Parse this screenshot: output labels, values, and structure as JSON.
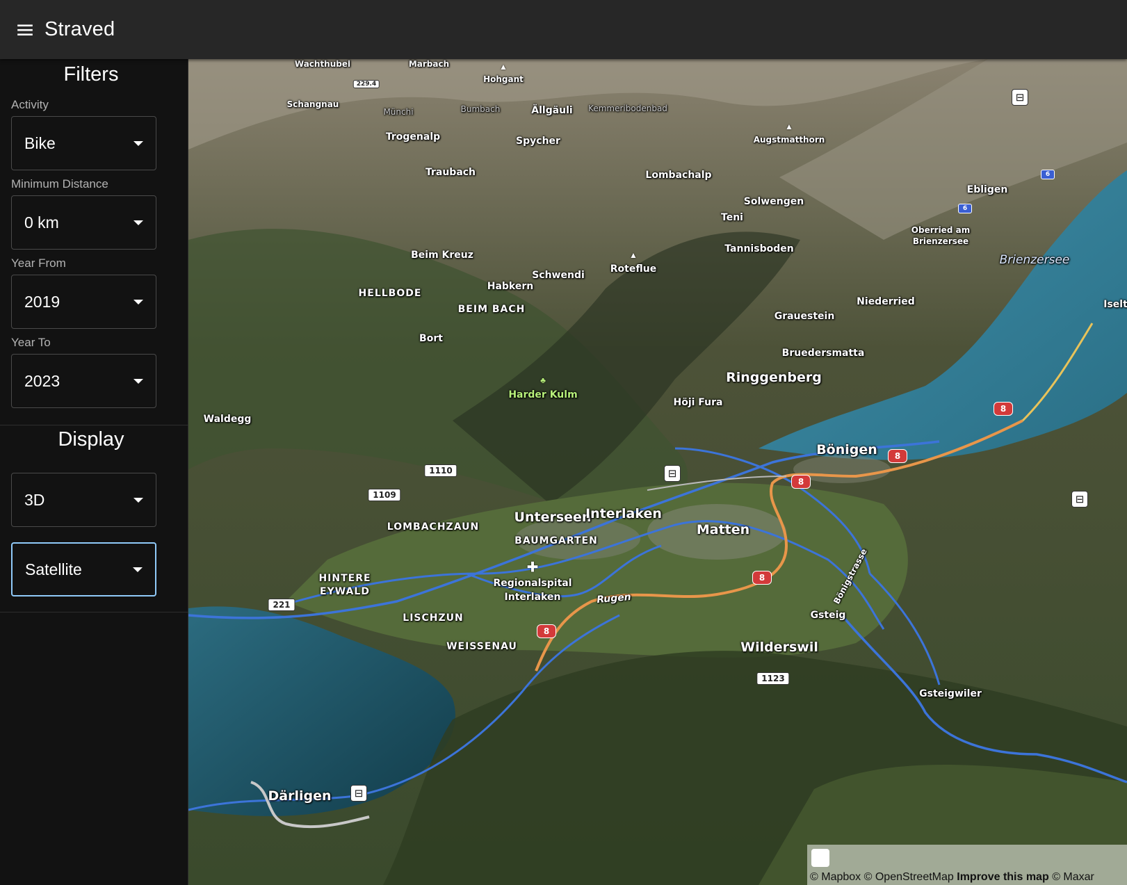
{
  "app": {
    "title": "Straved",
    "menu_icon": "hamburger-menu-icon"
  },
  "filters": {
    "title": "Filters",
    "activity": {
      "label": "Activity",
      "value": "Bike"
    },
    "min_distance": {
      "label": "Minimum Distance",
      "value": "0 km"
    },
    "year_from": {
      "label": "Year From",
      "value": "2019"
    },
    "year_to": {
      "label": "Year To",
      "value": "2023"
    }
  },
  "display": {
    "title": "Display",
    "view_mode": {
      "value": "3D"
    },
    "map_style": {
      "value": "Satellite"
    }
  },
  "map": {
    "labels": {
      "wachthubel": "Wachthubel",
      "marbach": "Marbach",
      "hohgant": "Hohgant",
      "schangnau": "Schangnau",
      "munchi": "Münchi",
      "bumbach": "Bumbach",
      "allgauli": "Ällgäuli",
      "kemmeribodenbad": "Kemmeribodenbad",
      "trogenalp": "Trogenalp",
      "spycher": "Spycher",
      "augstmatthorn": "Augstmatthorn",
      "traubach": "Traubach",
      "lombachalp": "Lombachalp",
      "ebligen": "Ebligen",
      "solwengen": "Solwengen",
      "teni": "Teni",
      "oberried": "Oberried am",
      "oberried2": "Brienzersee",
      "tannisboden": "Tannisboden",
      "brienzersee": "Brienzersee",
      "beim_kreuz": "Beim Kreuz",
      "schwendi": "Schwendi",
      "roteflue": "Roteflue",
      "hellbode": "HELLBODE",
      "habkern": "Habkern",
      "beim_bach": "BEIM BACH",
      "niederried": "Niederried",
      "iseltwald": "Iseltw",
      "grauestein": "Grauestein",
      "bort": "Bort",
      "bruedersmatta": "Bruedersmatta",
      "ringgenberg": "Ringgenberg",
      "harder_kulm": "Harder Kulm",
      "hoji_fura": "Höji Fura",
      "waldegg": "Waldegg",
      "bonigen": "Bönigen",
      "unterseen": "Unterseen",
      "interlaken": "Interlaken",
      "lombachzaun": "LOMBACHZAUN",
      "baumgarten": "BAUMGARTEN",
      "matten": "Matten",
      "regionalspital": "Regionalspital",
      "regionalspital2": "Interlaken",
      "hintere": "HINTERE",
      "eywald": "EYWALD",
      "rugen": "Rugen",
      "bonigstrasse": "Bönigstrasse",
      "lischzun": "LISCHZUN",
      "gsteig": "Gsteig",
      "weissenau": "WEISSENAU",
      "wilderswil": "Wilderswil",
      "gsteigwiler": "Gsteigwiler",
      "darligen": "Därligen"
    },
    "road_shields": {
      "r229": "229.4",
      "r1110": "1110",
      "r1109": "1109",
      "r221": "221",
      "r1123": "1123"
    },
    "badges": {
      "a8": "8",
      "a6": "6"
    },
    "attribution": {
      "mapbox": "© Mapbox",
      "osm": "© OpenStreetMap",
      "improve": "Improve this map",
      "maxar": "© Maxar"
    }
  }
}
